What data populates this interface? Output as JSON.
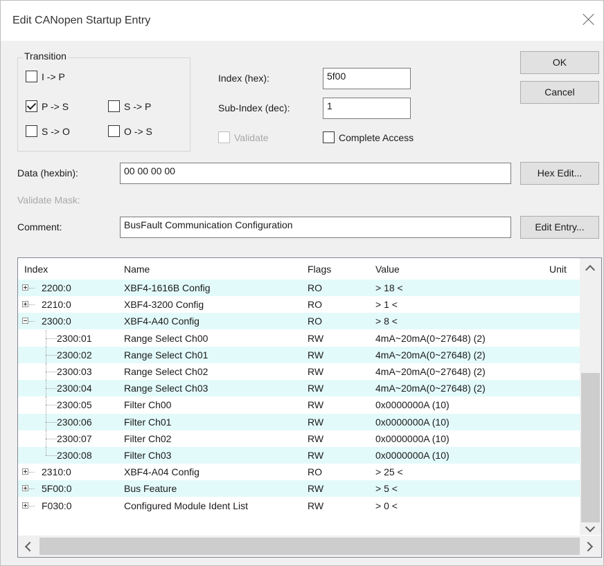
{
  "dialog": {
    "title": "Edit CANopen Startup Entry"
  },
  "transition": {
    "label": "Transition",
    "items": [
      {
        "label": "I -> P",
        "checked": false
      },
      {
        "label": "P -> S",
        "checked": true
      },
      {
        "label": "S -> P",
        "checked": false
      },
      {
        "label": "S -> O",
        "checked": false
      },
      {
        "label": "O -> S",
        "checked": false
      }
    ]
  },
  "fields": {
    "index_label": "Index (hex):",
    "index_value": "5f00",
    "subindex_label": "Sub-Index (dec):",
    "subindex_value": "1",
    "validate_label": "Validate",
    "complete_access_label": "Complete Access",
    "data_label": "Data (hexbin):",
    "data_value": "00 00 00 00",
    "validate_mask_label": "Validate Mask:",
    "comment_label": "Comment:",
    "comment_value": "BusFault Communication Configuration"
  },
  "buttons": {
    "ok": "OK",
    "cancel": "Cancel",
    "hex_edit": "Hex Edit...",
    "edit_entry": "Edit Entry..."
  },
  "table": {
    "columns": [
      "Index",
      "Name",
      "Flags",
      "Value",
      "Unit"
    ],
    "rows": [
      {
        "index": "2200:0",
        "name": "XBF4-1616B Config",
        "flags": "RO",
        "value": "> 18 <",
        "expander": "plus"
      },
      {
        "index": "2210:0",
        "name": "XBF4-3200 Config",
        "flags": "RO",
        "value": "> 1 <",
        "expander": "plus"
      },
      {
        "index": "2300:0",
        "name": "XBF4-A40 Config",
        "flags": "RO",
        "value": "> 8 <",
        "expander": "minus"
      },
      {
        "index": "2300:01",
        "name": "Range Select Ch00",
        "flags": "RW",
        "value": "4mA~20mA(0~27648) (2)",
        "expander": "child"
      },
      {
        "index": "2300:02",
        "name": "Range Select Ch01",
        "flags": "RW",
        "value": "4mA~20mA(0~27648) (2)",
        "expander": "child"
      },
      {
        "index": "2300:03",
        "name": "Range Select Ch02",
        "flags": "RW",
        "value": "4mA~20mA(0~27648) (2)",
        "expander": "child"
      },
      {
        "index": "2300:04",
        "name": "Range Select Ch03",
        "flags": "RW",
        "value": "4mA~20mA(0~27648) (2)",
        "expander": "child"
      },
      {
        "index": "2300:05",
        "name": "Filter Ch00",
        "flags": "RW",
        "value": "0x0000000A (10)",
        "expander": "child"
      },
      {
        "index": "2300:06",
        "name": "Filter Ch01",
        "flags": "RW",
        "value": "0x0000000A (10)",
        "expander": "child"
      },
      {
        "index": "2300:07",
        "name": "Filter Ch02",
        "flags": "RW",
        "value": "0x0000000A (10)",
        "expander": "child"
      },
      {
        "index": "2300:08",
        "name": "Filter Ch03",
        "flags": "RW",
        "value": "0x0000000A (10)",
        "expander": "child"
      },
      {
        "index": "2310:0",
        "name": "XBF4-A04 Config",
        "flags": "RO",
        "value": "> 25 <",
        "expander": "plus"
      },
      {
        "index": "5F00:0",
        "name": "Bus Feature",
        "flags": "RW",
        "value": "> 5 <",
        "expander": "plus"
      },
      {
        "index": "F030:0",
        "name": "Configured Module Ident List",
        "flags": "RW",
        "value": "> 0 <",
        "expander": "plus"
      }
    ]
  },
  "colors": {
    "row_alt": "#e3fafa"
  }
}
